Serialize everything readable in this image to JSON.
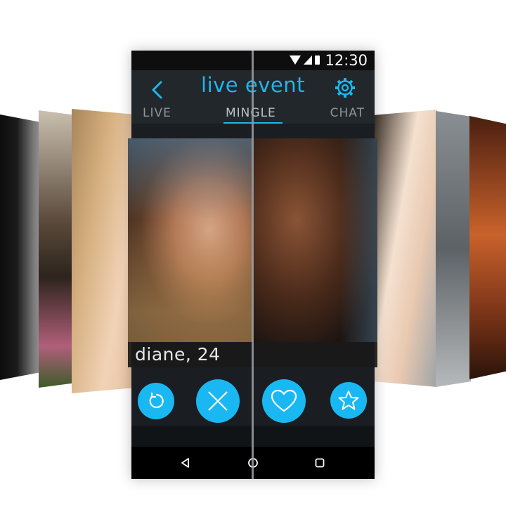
{
  "status_bar": {
    "time": "12:30"
  },
  "app_bar": {
    "title": "live event",
    "back_icon": "chevron-left-icon",
    "settings_icon": "gear-icon"
  },
  "tabs": [
    {
      "label": "LIVE",
      "active": false
    },
    {
      "label": "MINGLE",
      "active": true
    },
    {
      "label": "CHAT",
      "active": false
    }
  ],
  "profile_card": {
    "caption": "diane, 24"
  },
  "actions": {
    "undo_icon": "undo-icon",
    "pass_icon": "close-icon",
    "like_icon": "heart-icon",
    "superlike_icon": "star-icon"
  },
  "nav_bar": {
    "back_icon": "triangle-back-icon",
    "home_icon": "circle-home-icon",
    "recents_icon": "square-recents-icon"
  },
  "colors": {
    "accent": "#19b8f2",
    "app_bar": "#22272b",
    "status_bar": "#0e0e0e"
  }
}
